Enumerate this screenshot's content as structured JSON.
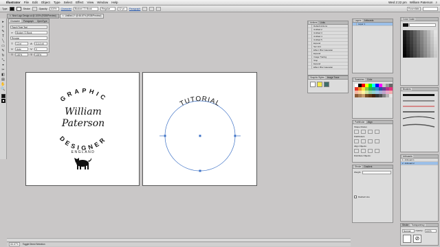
{
  "menubar": {
    "app": "Illustrator",
    "items": [
      "File",
      "Edit",
      "Object",
      "Type",
      "Select",
      "Effect",
      "View",
      "Window",
      "Help"
    ],
    "clock": "Wed 2:22 pm",
    "user": "William Paterson"
  },
  "controlbar": {
    "label_type": "Type",
    "stroke_label": "Stroke",
    "opacity_label": "Opacity",
    "opacity_value": "100%",
    "character_label": "Character",
    "font_value": "Bodoni 72 Book",
    "style_value": "Regular",
    "size_value": "12 pt",
    "paragraph_label": "Paragraph",
    "workspace_value": "Essentials"
  },
  "doctabs": [
    {
      "label": "New Logo Design.ai @ 100% (RGB/Preview)",
      "close": "×"
    },
    {
      "label": "Untitled-1* @ 66.67% (RGB/Preview)",
      "close": "×"
    }
  ],
  "tools": [
    "▸",
    "▹",
    "✎",
    "T",
    "╲",
    "▭",
    "✎",
    "↻",
    "⤡",
    "⌖",
    "✂",
    "◧",
    "▤",
    "✋",
    "🔍"
  ],
  "character_panel": {
    "tabs": [
      "Character",
      "Paragraph",
      "OpenType"
    ],
    "search_label": "Touch Type Tool",
    "font": "Bodoni 72 Book",
    "style": "Regular",
    "size": "12 pt",
    "leading": "(14.4 pt)",
    "kerning": "Auto",
    "tracking": "0",
    "vscale": "100%",
    "hscale": "100%"
  },
  "artboard1": {
    "top_text": "GRAPHIC",
    "script1": "William",
    "script2": "Paterson",
    "bottom_text": "DESIGNER",
    "country": "ENGLAND"
  },
  "artboard2": {
    "arc_text": "TUTORIAL"
  },
  "actions_panel": {
    "tabs": [
      "Actions",
      "Links"
    ],
    "rows": [
      "Default Actions",
      "Untitled 2",
      "Untitled 3",
      "Untitled 4",
      "Untitled 5",
      "Expand",
      "Set Unit",
      "Effect: Blur Gaussian",
      "Expand",
      "Image Tracing",
      "Stop",
      "Expand",
      "Effect: Blur Gaussian"
    ]
  },
  "layers_panel": {
    "tabs": [
      "Layers",
      "Artboards"
    ],
    "rows": [
      "Layer 1"
    ]
  },
  "graphic_styles_panel": {
    "tabs": [
      "Graphic Styles",
      "Image Trace"
    ]
  },
  "swatches_panel": {
    "tabs": [
      "Swatches",
      "Color"
    ]
  },
  "pathfinder_panel": {
    "tabs": [
      "Pathfinder",
      "Align"
    ],
    "shape_modes_label": "Shape Modes:",
    "pathfinders_label": "Pathfinders:",
    "align_objects_label": "Align Objects:",
    "distribute_objects_label": "Distribute Objects:"
  },
  "stroke_panel": {
    "tabs": [
      "Stroke",
      "Gradient"
    ],
    "weight_label": "Weight:",
    "dashed_label": "Dashed Line"
  },
  "color_guide_panel": {
    "tabs": [
      "Color Guide"
    ]
  },
  "brushes_panel": {
    "tabs": [
      "Brushes"
    ],
    "size_label": "5.00"
  },
  "artboards_panel": {
    "tabs": [
      "Artboards"
    ],
    "rows": [
      {
        "num": "1",
        "name": "Artboard 1"
      },
      {
        "num": "2",
        "name": "Artboard 2"
      }
    ]
  },
  "transparency_panel": {
    "tabs": [
      "Stroke",
      "Transparency"
    ],
    "mode": "Normal",
    "opacity_label": "Opacity:",
    "opacity_value": "100%"
  },
  "statusbar": {
    "zoom": "66.67%",
    "tool_hint": "Toggle Direct Selection"
  },
  "colors": {
    "accent": "#3a6fc5",
    "canvas": "#c9c7c7"
  }
}
